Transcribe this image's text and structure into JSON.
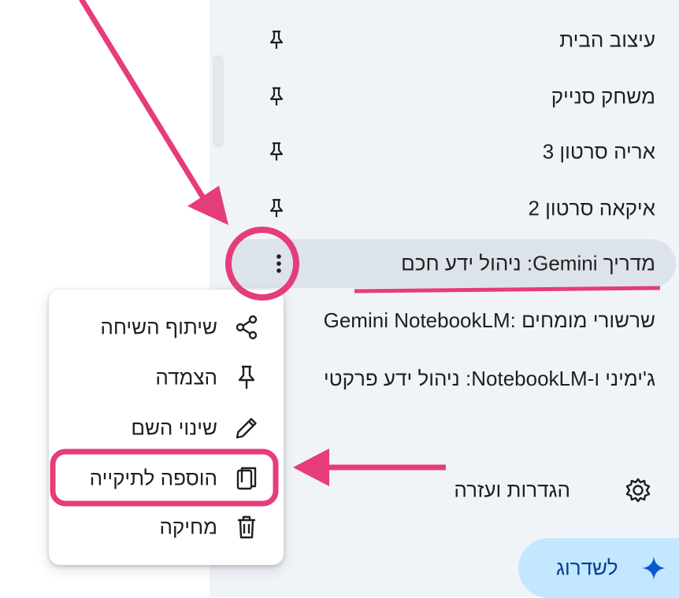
{
  "chats": [
    {
      "title": "עיצוב הבית",
      "icon": "pin-icon"
    },
    {
      "title": "משחק סנייק",
      "icon": "pin-icon"
    },
    {
      "title": "אריה סרטון 3",
      "icon": "pin-icon"
    },
    {
      "title": "איקאה סרטון 2",
      "icon": "pin-icon"
    },
    {
      "title": "מדריך Gemini: ניהול ידע חכם",
      "icon": "more-vert-icon",
      "active": true
    },
    {
      "title": "שרשורי מומחים :NotebookLM‏ Gemini",
      "partial": true
    },
    {
      "title": "ג'ימיני ו-NotebookLM: ניהול ידע פרקטי",
      "partial": true
    }
  ],
  "settings": {
    "label": "הגדרות ועזרה",
    "icon": "gear-icon"
  },
  "upgrade": {
    "label": "לשדרוג",
    "icon": "sparkle-icon"
  },
  "menu": {
    "items": [
      {
        "label": "שיתוף השיחה",
        "icon": "share-icon"
      },
      {
        "label": "הצמדה",
        "icon": "pin-icon"
      },
      {
        "label": "שינוי השם",
        "icon": "pencil-icon"
      },
      {
        "label": "הוספה לתיקייה",
        "icon": "folder-add-icon",
        "highlighted": true
      },
      {
        "label": "מחיקה",
        "icon": "trash-icon"
      }
    ]
  },
  "colors": {
    "annotation": "#e53c7c",
    "sidebar_bg": "#f0f4f9",
    "active_bg": "#dde3ea",
    "upgrade_bg": "#c2e7ff",
    "upgrade_text": "#0b3d91",
    "sparkle": "#0b57d0"
  }
}
